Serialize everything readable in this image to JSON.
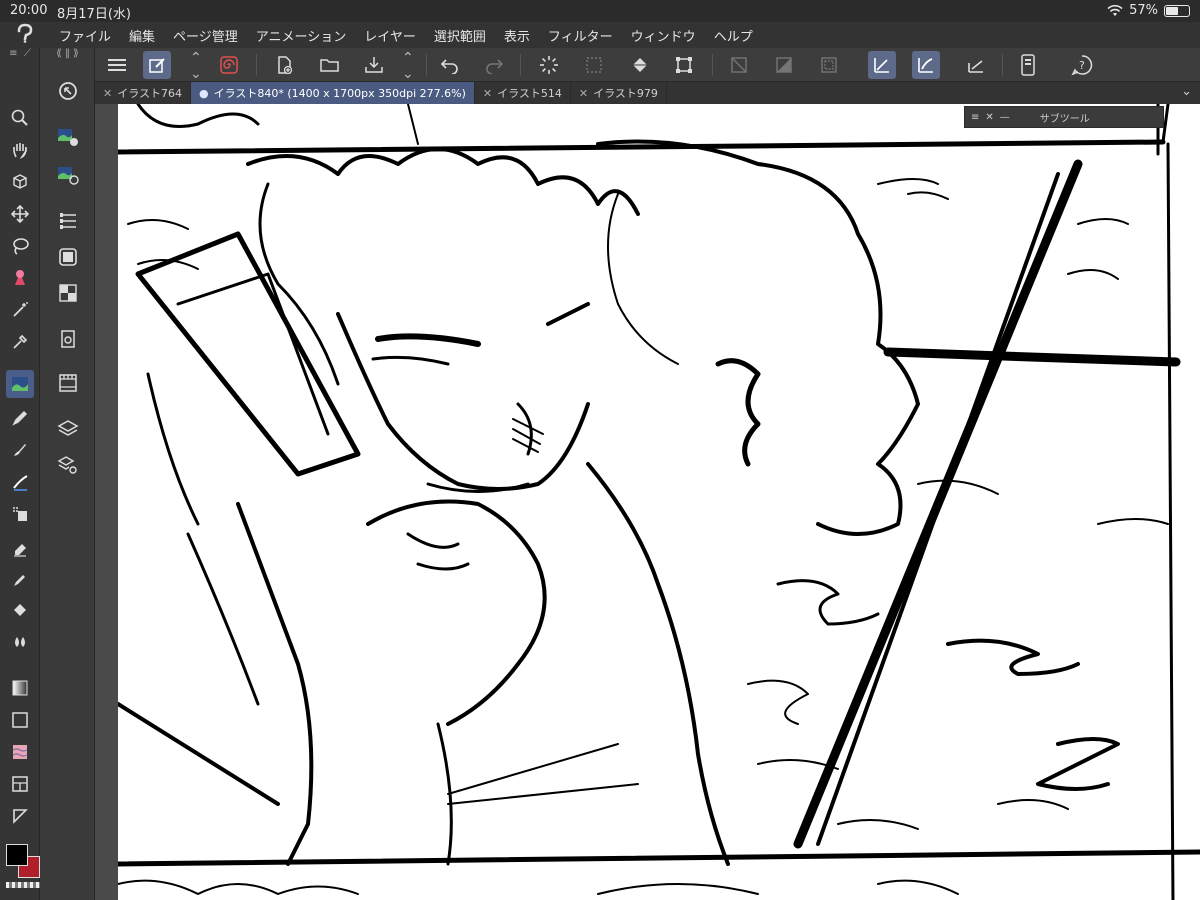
{
  "status": {
    "time": "20:00",
    "date": "8月17日(水)",
    "battery": "57%",
    "battery_level": 0.57
  },
  "menu": {
    "items": [
      "ファイル",
      "編集",
      "ページ管理",
      "アニメーション",
      "レイヤー",
      "選択範囲",
      "表示",
      "フィルター",
      "ウィンドウ",
      "ヘルプ"
    ]
  },
  "tabs": [
    {
      "label": "イラスト764",
      "active": false
    },
    {
      "label": "イラスト840* (1400 x 1700px 350dpi 277.6%)",
      "active": true
    },
    {
      "label": "イラスト514",
      "active": false
    },
    {
      "label": "イラスト979",
      "active": false
    }
  ],
  "subtool_palette": {
    "title": "サブツール"
  },
  "colors": {
    "accent": "#4a5a80",
    "main_color": "#000000",
    "sub_color": "#b0202a"
  }
}
